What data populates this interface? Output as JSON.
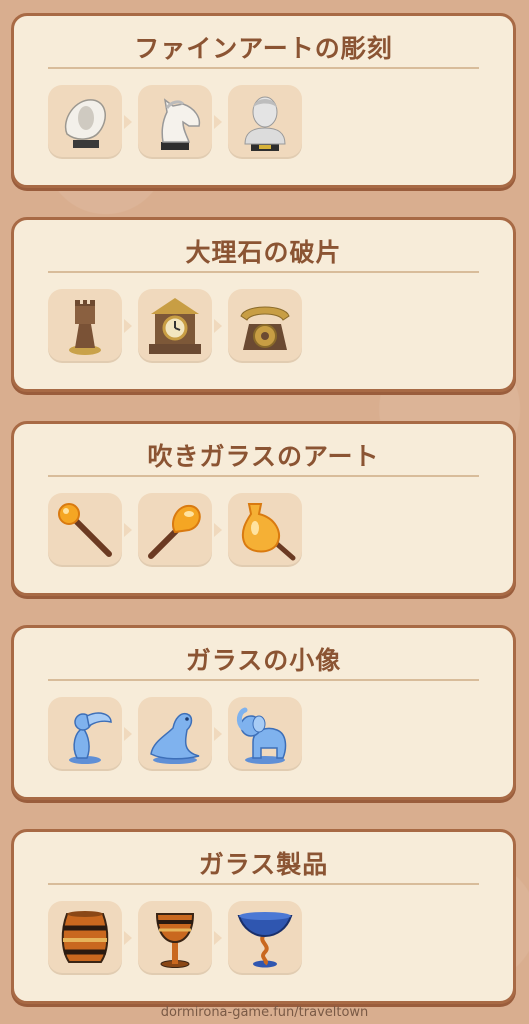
{
  "cards": [
    {
      "title": "ファインアートの彫刻",
      "items": [
        {
          "icon": "abstract-sculpture-icon"
        },
        {
          "icon": "horse-head-sculpture-icon"
        },
        {
          "icon": "bust-sculpture-icon"
        }
      ]
    },
    {
      "title": "大理石の破片",
      "items": [
        {
          "icon": "chess-rook-icon"
        },
        {
          "icon": "mantel-clock-icon"
        },
        {
          "icon": "rotary-telephone-icon"
        }
      ]
    },
    {
      "title": "吹きガラスのアート",
      "items": [
        {
          "icon": "glassblowing-rod-small-icon"
        },
        {
          "icon": "glassblowing-rod-large-icon"
        },
        {
          "icon": "glassblowing-vase-icon"
        }
      ]
    },
    {
      "title": "ガラスの小像",
      "items": [
        {
          "icon": "glass-toucan-icon"
        },
        {
          "icon": "glass-seal-icon"
        },
        {
          "icon": "glass-elephant-icon"
        }
      ]
    },
    {
      "title": "ガラス製品",
      "items": [
        {
          "icon": "striped-glass-vase-icon"
        },
        {
          "icon": "striped-goblet-icon"
        },
        {
          "icon": "blue-goblet-icon"
        }
      ]
    }
  ],
  "footer": "dormirona-game.fun/traveltown"
}
